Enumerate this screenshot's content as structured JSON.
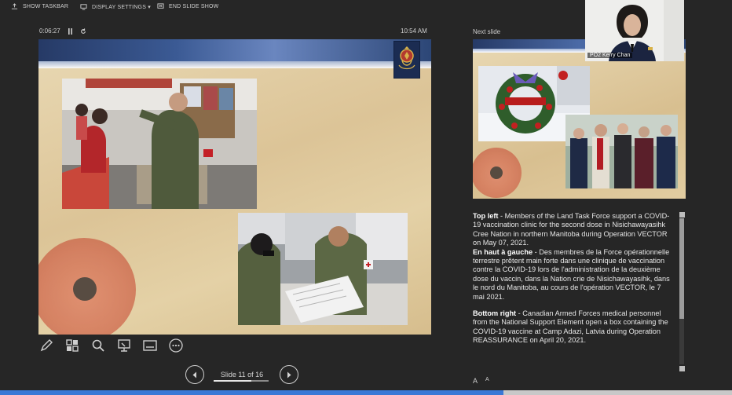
{
  "toolbar": {
    "show_taskbar": "SHOW TASKBAR",
    "display_settings": "DISPLAY SETTINGS ▾",
    "end_slide_show": "END SLIDE SHOW"
  },
  "presenter": {
    "elapsed": "0:06:27",
    "clock": "10:54 AM",
    "next_slide_label": "Next slide",
    "slide_counter": "Slide 11 of 16",
    "current_slide": 11,
    "total_slides": 16
  },
  "webcam": {
    "name": "PO2 Kerry Chan"
  },
  "notes": {
    "p1_heading": "Top left",
    "p1_text": " - Members of the Land Task Force support a COVID-19 vaccination clinic for the second dose in Nisichawayasihk Cree Nation in northern Manitoba during Operation VECTOR on May 07, 2021.",
    "p2_heading": "En haut à gauche",
    "p2_text": " - Des membres de la Force opérationnelle terrestre prêtent main forte dans une clinique de vaccination contre la COVID-19 lors de l'administration de la deuxième dose du vaccin, dans la Nation crie de Nisichawayasihk, dans le nord du Manitoba, au cours de l'opération VECTOR, le 7 mai 2021.",
    "p3_heading": "Bottom right",
    "p3_text": " - Canadian Armed Forces medical personnel from the National Support Element open a box containing the COVID-19 vaccine at Camp Adazi, Latvia during Operation REASSURANCE on April 20, 2021."
  },
  "font_buttons": {
    "increase": "A",
    "decrease": "A"
  },
  "icons": [
    "taskbar-icon",
    "display-settings-icon",
    "end-show-icon",
    "pause-icon",
    "restart-icon",
    "pen-icon",
    "grid-icon",
    "zoom-icon",
    "pointer-icon",
    "subtitles-icon",
    "more-icon",
    "prev-icon",
    "next-icon",
    "crest-icon"
  ],
  "colors": {
    "background": "#262626",
    "progress": "#3a78d6",
    "banner": "#263a66"
  }
}
